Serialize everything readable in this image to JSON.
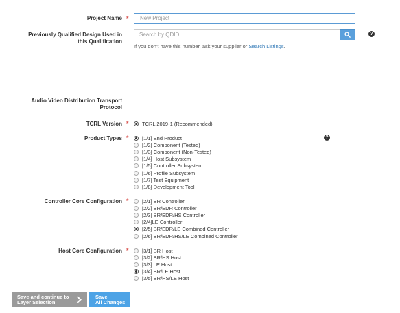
{
  "project_name": {
    "label": "Project Name",
    "required": "*",
    "placeholder": "New Project"
  },
  "qdid": {
    "label_line1": "Previously Qualified Design Used in",
    "label_line2": "this Qualification",
    "placeholder": "Search by QDID",
    "hint_text": "If you don't have this number, ask your supplier or ",
    "hint_link": "Search Listings",
    "hint_end": "."
  },
  "avdtp": {
    "label_line1": "Audio Video Distribution Transport",
    "label_line2": "Protocol"
  },
  "tcrl": {
    "label": "TCRL Version",
    "required": "*",
    "options": [
      {
        "label": "TCRL 2019-1 (Recommended)",
        "selected": true
      }
    ]
  },
  "product_types": {
    "label": "Product Types",
    "required": "*",
    "options": [
      {
        "label": "[1/1] End Product",
        "selected": true
      },
      {
        "label": "[1/2] Component (Tested)",
        "selected": false
      },
      {
        "label": "[1/3] Component (Non-Tested)",
        "selected": false
      },
      {
        "label": "[1/4] Host Subsystem",
        "selected": false
      },
      {
        "label": "[1/5] Controller Subsystem",
        "selected": false
      },
      {
        "label": "[1/6] Profile Subsystem",
        "selected": false
      },
      {
        "label": "[1/7] Test Equipment",
        "selected": false
      },
      {
        "label": "[1/8] Development Tool",
        "selected": false
      }
    ]
  },
  "controller_core": {
    "label": "Controller Core Configuration",
    "required": "*",
    "options": [
      {
        "label": "[2/1] BR Controller",
        "selected": false
      },
      {
        "label": "[2/2] BR/EDR Controller",
        "selected": false
      },
      {
        "label": "[2/3] BR/EDR/HS Controller",
        "selected": false
      },
      {
        "label": "[2/4]LE Controller",
        "selected": false
      },
      {
        "label": "[2/5] BR/EDR/LE Combined Controller",
        "selected": true
      },
      {
        "label": "[2/6] BR/EDR/HS/LE Combined Controller",
        "selected": false
      }
    ]
  },
  "host_core": {
    "label": "Host Core Configuration",
    "required": "*",
    "options": [
      {
        "label": "[3/1] BR Host",
        "selected": false
      },
      {
        "label": "[3/2] BR/HS Host",
        "selected": false
      },
      {
        "label": "[3/3] LE Host",
        "selected": false
      },
      {
        "label": "[3/4] BR/LE Host",
        "selected": true
      },
      {
        "label": "[3/5] BR/HS/LE Host",
        "selected": false
      }
    ]
  },
  "help_icon_glyph": "?",
  "footer": {
    "save_continue_line1": "Save and continue to",
    "save_continue_line2": "Layer Selection",
    "save_all_line1": "Save",
    "save_all_line2": "All Changes"
  },
  "colors": {
    "accent": "#4da3e6",
    "required": "#d9534f",
    "link": "#337ab7",
    "secondary_button": "#9a9a9a"
  }
}
